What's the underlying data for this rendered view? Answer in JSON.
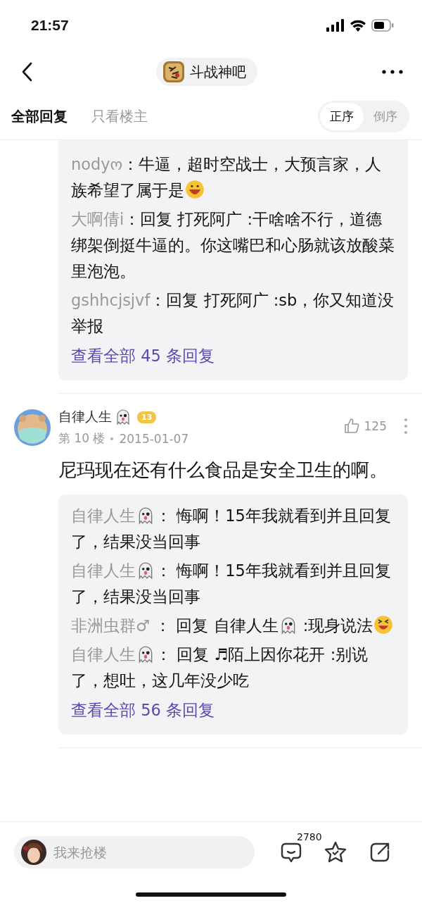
{
  "status_bar": {
    "time": "21:57"
  },
  "nav": {
    "forum": "斗战神吧"
  },
  "tabs": [
    {
      "label": "全部回复",
      "selected": true
    },
    {
      "label": "只看楼主",
      "selected": false
    }
  ],
  "order": [
    {
      "label": "正序",
      "selected": true
    },
    {
      "label": "倒序",
      "selected": false
    }
  ],
  "threads": [
    {
      "kind": "replies_only",
      "replies": [
        [
          {
            "kind": "user",
            "text": "nodyო"
          },
          {
            "kind": "text",
            "text": "：牛逼，超时空战士，大预言家，人族希望了属于是"
          },
          {
            "kind": "grin"
          }
        ],
        [
          {
            "kind": "user",
            "text": "大啊倩i"
          },
          {
            "kind": "text",
            "text": "：回复 打死阿广 :干啥啥不行，道德绑架倒挺牛逼的。你这嘴巴和心肠就该放酸菜里泡泡。"
          }
        ],
        [
          {
            "kind": "user",
            "text": "gshhcjsjvf"
          },
          {
            "kind": "text",
            "text": "：回复 打死阿广 :sb，你又知道没举报"
          }
        ]
      ],
      "more": "查看全部 45 条回复"
    },
    {
      "kind": "post",
      "author": "自律人生",
      "floor": "第 10 楼",
      "date": "2015-01-07",
      "level": "13",
      "likes": "125",
      "content": "尼玛现在还有什么食品是安全卫生的啊。",
      "replies": [
        [
          {
            "kind": "user",
            "text": "自律人生"
          },
          {
            "kind": "ghost"
          },
          {
            "kind": "text",
            "text": "： 悔啊！15年我就看到并且回复了，结果没当回事"
          }
        ],
        [
          {
            "kind": "user",
            "text": "自律人生"
          },
          {
            "kind": "ghost"
          },
          {
            "kind": "text",
            "text": "： 悔啊！15年我就看到并且回复了，结果没当回事"
          }
        ],
        [
          {
            "kind": "user",
            "text": "非洲虫群♂"
          },
          {
            "kind": "text",
            "text": " ： 回复 自律人生"
          },
          {
            "kind": "ghost"
          },
          {
            "kind": "text",
            "text": " :现身说法"
          },
          {
            "kind": "laugh"
          }
        ],
        [
          {
            "kind": "user",
            "text": "自律人生"
          },
          {
            "kind": "ghost"
          },
          {
            "kind": "text",
            "text": "： 回复 ♬陌上因你花开 :别说了，想吐，这几年没少吃"
          }
        ]
      ],
      "more": "查看全部 56 条回复"
    }
  ],
  "bottom_bar": {
    "placeholder": "我来抢楼",
    "comment_count": "2780"
  }
}
